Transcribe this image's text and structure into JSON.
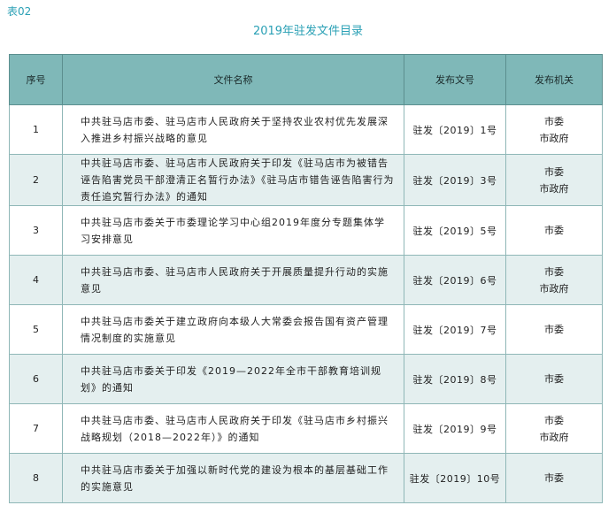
{
  "header": {
    "tag": "表02",
    "title": "2019年驻发文件目录"
  },
  "table": {
    "columns": [
      "序号",
      "文件名称",
      "发布文号",
      "发布机关"
    ],
    "rows": [
      {
        "no": "1",
        "name": "中共驻马店市委、驻马店市人民政府关于坚持农业农村优先发展深入推进乡村振兴战略的意见",
        "num": "驻发〔2019〕1号",
        "org": [
          "市委",
          "市政府"
        ]
      },
      {
        "no": "2",
        "name": "中共驻马店市委、驻马店市人民政府关于印发《驻马店市为被错告诬告陷害党员干部澄清正名暂行办法》《驻马店市错告诬告陷害行为责任追究暂行办法》的通知",
        "num": "驻发〔2019〕3号",
        "org": [
          "市委",
          "市政府"
        ]
      },
      {
        "no": "3",
        "name": "中共驻马店市委关于市委理论学习中心组2019年度分专题集体学习安排意见",
        "num": "驻发〔2019〕5号",
        "org": [
          "市委"
        ]
      },
      {
        "no": "4",
        "name": "中共驻马店市委、驻马店市人民政府关于开展质量提升行动的实施意见",
        "num": "驻发〔2019〕6号",
        "org": [
          "市委",
          "市政府"
        ]
      },
      {
        "no": "5",
        "name": "中共驻马店市委关于建立政府向本级人大常委会报告国有资产管理情况制度的实施意见",
        "num": "驻发〔2019〕7号",
        "org": [
          "市委"
        ]
      },
      {
        "no": "6",
        "name": "中共驻马店市委关于印发《2019—2022年全市干部教育培训规划》的通知",
        "num": "驻发〔2019〕8号",
        "org": [
          "市委"
        ]
      },
      {
        "no": "7",
        "name": "中共驻马店市委、驻马店市人民政府关于印发《驻马店市乡村振兴战略规划（2018—2022年）》的通知",
        "num": "驻发〔2019〕9号",
        "org": [
          "市委",
          "市政府"
        ]
      },
      {
        "no": "8",
        "name": "中共驻马店市委关于加强以新时代党的建设为根本的基层基础工作的实施意见",
        "num": "驻发〔2019〕10号",
        "org": [
          "市委"
        ]
      }
    ]
  }
}
